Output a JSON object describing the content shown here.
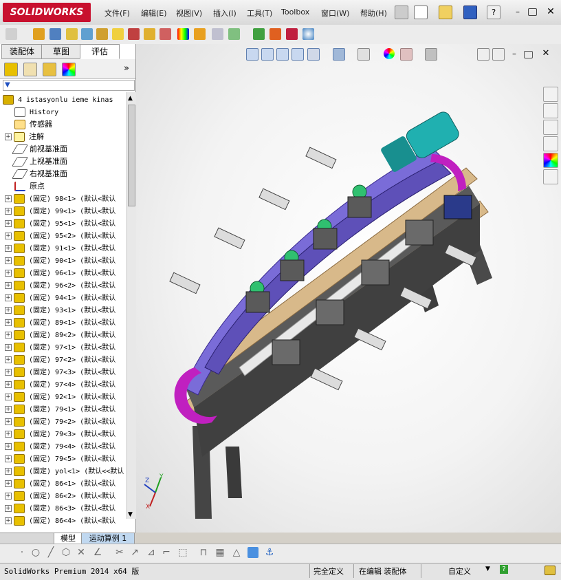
{
  "app": {
    "logo_text": "SOLIDWORKS",
    "menu": [
      "文件(F)",
      "编辑(E)",
      "视图(V)",
      "插入(I)",
      "工具(T)",
      "Toolbox",
      "窗口(W)",
      "帮助(H)"
    ]
  },
  "panel": {
    "tabs": [
      "装配体",
      "草图",
      "评估"
    ],
    "active_tab": "评估",
    "filter_symbol": "▼",
    "expand_symbol": "»",
    "tree_root": "4 istasyonlu ieme kinas",
    "tree_items": [
      {
        "label": "History",
        "icon": "history-icon",
        "pm": "",
        "ml": true
      },
      {
        "label": "传感器",
        "icon": "sensor-icon",
        "pm": "",
        "ml": false
      },
      {
        "label": "注解",
        "icon": "annotation-icon",
        "pm": "+",
        "ml": false
      },
      {
        "label": "前视基准面",
        "icon": "plane-icon",
        "pm": "",
        "ml": false
      },
      {
        "label": "上视基准面",
        "icon": "plane-icon",
        "pm": "",
        "ml": false
      },
      {
        "label": "右视基准面",
        "icon": "plane-icon",
        "pm": "",
        "ml": false
      },
      {
        "label": "原点",
        "icon": "origin-icon",
        "pm": "",
        "ml": false
      },
      {
        "label": "(固定) 98<1> (默认<默认",
        "icon": "part-icon",
        "pm": "+",
        "ml": true
      },
      {
        "label": "(固定) 99<1> (默认<默认",
        "icon": "part-icon",
        "pm": "+",
        "ml": true
      },
      {
        "label": "(固定) 95<1> (默认<默认",
        "icon": "part-icon",
        "pm": "+",
        "ml": true
      },
      {
        "label": "(固定) 95<2> (默认<默认",
        "icon": "part-icon",
        "pm": "+",
        "ml": true
      },
      {
        "label": "(固定) 91<1> (默认<默认",
        "icon": "part-icon",
        "pm": "+",
        "ml": true
      },
      {
        "label": "(固定) 90<1> (默认<默认",
        "icon": "part-icon",
        "pm": "+",
        "ml": true
      },
      {
        "label": "(固定) 96<1> (默认<默认",
        "icon": "part-icon",
        "pm": "+",
        "ml": true
      },
      {
        "label": "(固定) 96<2> (默认<默认",
        "icon": "part-icon",
        "pm": "+",
        "ml": true
      },
      {
        "label": "(固定) 94<1> (默认<默认",
        "icon": "part-icon",
        "pm": "+",
        "ml": true
      },
      {
        "label": "(固定) 93<1> (默认<默认",
        "icon": "part-icon",
        "pm": "+",
        "ml": true
      },
      {
        "label": "(固定) 89<1> (默认<默认",
        "icon": "part-icon",
        "pm": "+",
        "ml": true
      },
      {
        "label": "(固定) 89<2> (默认<默认",
        "icon": "part-icon",
        "pm": "+",
        "ml": true
      },
      {
        "label": "(固定) 97<1> (默认<默认",
        "icon": "part-icon",
        "pm": "+",
        "ml": true
      },
      {
        "label": "(固定) 97<2> (默认<默认",
        "icon": "part-icon",
        "pm": "+",
        "ml": true
      },
      {
        "label": "(固定) 97<3> (默认<默认",
        "icon": "part-icon",
        "pm": "+",
        "ml": true
      },
      {
        "label": "(固定) 97<4> (默认<默认",
        "icon": "part-icon",
        "pm": "+",
        "ml": true
      },
      {
        "label": "(固定) 92<1> (默认<默认",
        "icon": "part-icon",
        "pm": "+",
        "ml": true
      },
      {
        "label": "(固定) 79<1> (默认<默认",
        "icon": "part-icon",
        "pm": "+",
        "ml": true
      },
      {
        "label": "(固定) 79<2> (默认<默认",
        "icon": "part-icon",
        "pm": "+",
        "ml": true
      },
      {
        "label": "(固定) 79<3> (默认<默认",
        "icon": "part-icon",
        "pm": "+",
        "ml": true
      },
      {
        "label": "(固定) 79<4> (默认<默认",
        "icon": "part-icon",
        "pm": "+",
        "ml": true
      },
      {
        "label": "(固定) 79<5> (默认<默认",
        "icon": "part-icon",
        "pm": "+",
        "ml": true
      },
      {
        "label": "(固定) yol<1> (默认<<默认",
        "icon": "part-icon",
        "pm": "+",
        "ml": true
      },
      {
        "label": "(固定) 86<1> (默认<默认",
        "icon": "part-icon",
        "pm": "+",
        "ml": true
      },
      {
        "label": "(固定) 86<2> (默认<默认",
        "icon": "part-icon",
        "pm": "+",
        "ml": true
      },
      {
        "label": "(固定) 86<3> (默认<默认",
        "icon": "part-icon",
        "pm": "+",
        "ml": true
      },
      {
        "label": "(固定) 86<4> (默认<默认",
        "icon": "part-icon",
        "pm": "+",
        "ml": true
      }
    ],
    "bottom_tabs": [
      "模型",
      "运动算例 1"
    ]
  },
  "triad": {
    "x": "X",
    "y": "Y",
    "z": "Z"
  },
  "status": {
    "product": "SolidWorks Premium 2014 x64 版",
    "fully_defined": "完全定义",
    "editing": "在编辑 装配体",
    "units": "自定义",
    "units_arrow": "▼",
    "help_icon": "?"
  },
  "colors": {
    "frame": "#4a4a4a",
    "wood": "#d8b98a",
    "purple_plate": "#7a6cd8",
    "gear": "#c020c0",
    "motor": "#20b0b0",
    "sensor_green": "#30c070"
  }
}
